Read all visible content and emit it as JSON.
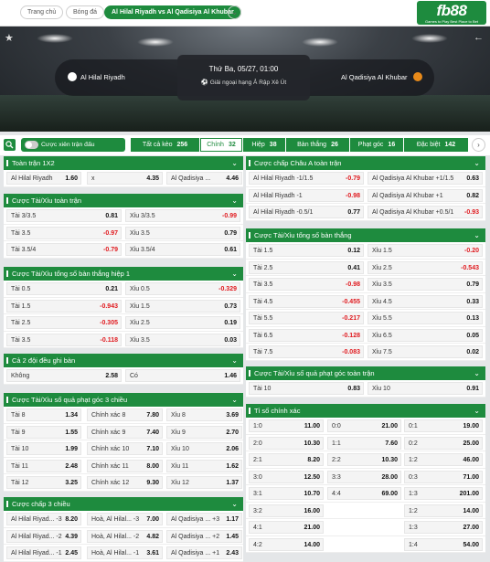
{
  "topbar": {
    "home": "Trang chủ",
    "football": "Bóng đá",
    "match": "Al Hilal Riyadh vs Al Qadisiya Al Khubar",
    "logo": "fb88",
    "logo_sub": "Games to Play Best Place to Bet"
  },
  "match": {
    "home_team": "Al Hilal Riyadh",
    "away_team": "Al Qadisiya Al Khubar",
    "datetime": "Thứ Ba, 05/27, 01:00",
    "league": "Giải ngoại hạng Ả Rập Xê Út"
  },
  "filter": {
    "toggle_label": "Cược xiên trận đấu",
    "tabs": [
      {
        "label": "Tất cả kèo",
        "count": "256"
      },
      {
        "label": "Chính",
        "count": "32"
      },
      {
        "label": "Hiệp",
        "count": "38"
      },
      {
        "label": "Bàn thắng",
        "count": "26"
      },
      {
        "label": "Phạt góc",
        "count": "16"
      },
      {
        "label": "Đặc biệt",
        "count": "142"
      }
    ]
  },
  "sections": [
    {
      "title": "Toàn trận 1X2",
      "rows": [
        [
          [
            "Al Hilal Riyadh",
            "1.60"
          ],
          [
            "x",
            "4.35"
          ],
          [
            "Al Qadisiya ...",
            "4.46"
          ]
        ]
      ]
    },
    {
      "title": "Cược Tài/Xỉu toàn trận",
      "rows": [
        [
          [
            "Tài 3/3.5",
            "0.81"
          ],
          [
            "Xỉu 3/3.5",
            "-0.99"
          ]
        ],
        [
          [
            "Tài 3.5",
            "-0.97"
          ],
          [
            "Xỉu 3.5",
            "0.79"
          ]
        ],
        [
          [
            "Tài 3.5/4",
            "-0.79"
          ],
          [
            "Xỉu 3.5/4",
            "0.61"
          ]
        ]
      ]
    },
    {
      "title": "Cược Tài/Xỉu tổng số bàn thắng hiệp 1",
      "rows": [
        [
          [
            "Tài 0.5",
            "0.21"
          ],
          [
            "Xỉu 0.5",
            "-0.329"
          ]
        ],
        [
          [
            "Tài 1.5",
            "-0.943"
          ],
          [
            "Xỉu 1.5",
            "0.73"
          ]
        ],
        [
          [
            "Tài 2.5",
            "-0.305"
          ],
          [
            "Xỉu 2.5",
            "0.19"
          ]
        ],
        [
          [
            "Tài 3.5",
            "-0.118"
          ],
          [
            "Xỉu 3.5",
            "0.03"
          ]
        ]
      ]
    },
    {
      "title": "Cả 2 đội đều ghi bàn",
      "rows": [
        [
          [
            "Không",
            "2.58"
          ],
          [
            "Có",
            "1.46"
          ]
        ]
      ]
    },
    {
      "title": "Cược Tài/Xỉu số quả phạt góc 3 chiều",
      "rows": [
        [
          [
            "Tài 8",
            "1.34"
          ],
          [
            "Chính xác 8",
            "7.80"
          ],
          [
            "Xỉu 8",
            "3.69"
          ]
        ],
        [
          [
            "Tài 9",
            "1.55"
          ],
          [
            "Chính xác 9",
            "7.40"
          ],
          [
            "Xỉu 9",
            "2.70"
          ]
        ],
        [
          [
            "Tài 10",
            "1.99"
          ],
          [
            "Chính xác 10",
            "7.10"
          ],
          [
            "Xỉu 10",
            "2.06"
          ]
        ],
        [
          [
            "Tài 11",
            "2.48"
          ],
          [
            "Chính xác 11",
            "8.00"
          ],
          [
            "Xỉu 11",
            "1.62"
          ]
        ],
        [
          [
            "Tài 12",
            "3.25"
          ],
          [
            "Chính xác 12",
            "9.30"
          ],
          [
            "Xỉu 12",
            "1.37"
          ]
        ]
      ]
    },
    {
      "title": "Cược chấp 3 chiều",
      "rows": [
        [
          [
            "Al Hilal Riyad... -3",
            "8.20"
          ],
          [
            "Hoà, Al Hilal... -3",
            "7.00"
          ],
          [
            "Al Qadisiya ... +3",
            "1.17"
          ]
        ],
        [
          [
            "Al Hilal Riyad... -2",
            "4.39"
          ],
          [
            "Hoà, Al Hilal... -2",
            "4.82"
          ],
          [
            "Al Qadisiya ... +2",
            "1.45"
          ]
        ],
        [
          [
            "Al Hilal Riyad... -1",
            "2.45"
          ],
          [
            "Hoà, Al Hilal... -1",
            "3.61"
          ],
          [
            "Al Qadisiya ... +1",
            "2.43"
          ]
        ]
      ]
    },
    {
      "title": "Cược chấp Châu A toàn trận",
      "rows": [
        [
          [
            "Al Hilal Riyadh -1/1.5",
            "-0.79"
          ],
          [
            "Al Qadisiya Al Khubar +1/1.5",
            "0.63"
          ]
        ],
        [
          [
            "Al Hilal Riyadh -1",
            "-0.98"
          ],
          [
            "Al Qadisiya Al Khubar +1",
            "0.82"
          ]
        ],
        [
          [
            "Al Hilal Riyadh -0.5/1",
            "0.77"
          ],
          [
            "Al Qadisiya Al Khubar +0.5/1",
            "-0.93"
          ]
        ]
      ]
    },
    {
      "title": "Cược Tài/Xỉu tổng số bàn thắng",
      "rows": [
        [
          [
            "Tài 1.5",
            "0.12"
          ],
          [
            "Xỉu 1.5",
            "-0.20"
          ]
        ],
        [
          [
            "Tài 2.5",
            "0.41"
          ],
          [
            "Xỉu 2.5",
            "-0.543"
          ]
        ],
        [
          [
            "Tài 3.5",
            "-0.98"
          ],
          [
            "Xỉu 3.5",
            "0.79"
          ]
        ],
        [
          [
            "Tài 4.5",
            "-0.455"
          ],
          [
            "Xỉu 4.5",
            "0.33"
          ]
        ],
        [
          [
            "Tài 5.5",
            "-0.217"
          ],
          [
            "Xỉu 5.5",
            "0.13"
          ]
        ],
        [
          [
            "Tài 6.5",
            "-0.128"
          ],
          [
            "Xỉu 6.5",
            "0.05"
          ]
        ],
        [
          [
            "Tài 7.5",
            "-0.083"
          ],
          [
            "Xỉu 7.5",
            "0.02"
          ]
        ]
      ]
    },
    {
      "title": "Cược Tài/Xỉu số quả phạt góc toàn trận",
      "rows": [
        [
          [
            "Tài 10",
            "0.83"
          ],
          [
            "Xỉu 10",
            "0.91"
          ]
        ]
      ]
    },
    {
      "title": "Tỉ số chính xác",
      "rows": [
        [
          [
            "1:0",
            "11.00"
          ],
          [
            "0:0",
            "21.00"
          ],
          [
            "0:1",
            "19.00"
          ]
        ],
        [
          [
            "2:0",
            "10.30"
          ],
          [
            "1:1",
            "7.60"
          ],
          [
            "0:2",
            "25.00"
          ]
        ],
        [
          [
            "2:1",
            "8.20"
          ],
          [
            "2:2",
            "10.30"
          ],
          [
            "1:2",
            "46.00"
          ]
        ],
        [
          [
            "3:0",
            "12.50"
          ],
          [
            "3:3",
            "28.00"
          ],
          [
            "0:3",
            "71.00"
          ]
        ],
        [
          [
            "3:1",
            "10.70"
          ],
          [
            "4:4",
            "69.00"
          ],
          [
            "1:3",
            "201.00"
          ]
        ],
        [
          [
            "3:2",
            "16.00"
          ],
          [
            "",
            ""
          ],
          [
            "1:2",
            "14.00"
          ]
        ],
        [
          [
            "4:1",
            "21.00"
          ],
          [
            "",
            ""
          ],
          [
            "1:3",
            "27.00"
          ]
        ],
        [
          [
            "4:2",
            "14.00"
          ],
          [
            "",
            ""
          ],
          [
            "1:4",
            "54.00"
          ]
        ]
      ]
    }
  ],
  "colors": {
    "brand": "#1e8b3e",
    "negative": "#e0191e"
  }
}
